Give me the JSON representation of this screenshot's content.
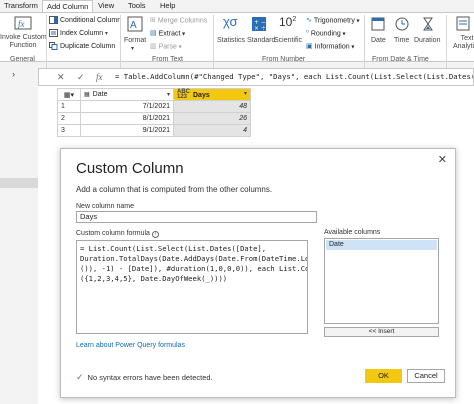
{
  "tabs": [
    "Transform",
    "Add Column",
    "View",
    "Tools",
    "Help"
  ],
  "ribbon": {
    "general": {
      "invoke_line1": "Invoke Custom",
      "invoke_line2": "Function",
      "group_label": "General"
    },
    "column_items": [
      "Conditional Column",
      "Index Column",
      "Duplicate Column"
    ],
    "from_text": {
      "format": "Format",
      "merge": "Merge Columns",
      "extract": "Extract",
      "parse": "Parse",
      "group_label": "From Text"
    },
    "from_number": {
      "statistics": "Statistics",
      "standard": "Standard",
      "scientific": "Scientific",
      "scientific_glyph": "10",
      "scientific_sup": "2",
      "trig": "Trigonometry",
      "rounding": "Rounding",
      "information": "Information",
      "group_label": "From Number"
    },
    "from_datetime": {
      "date": "Date",
      "time": "Time",
      "duration": "Duration",
      "group_label": "From Date & Time"
    },
    "text_analytics_line1": "Text",
    "text_analytics_line2": "Analytics"
  },
  "formula_bar": {
    "text": "= Table.AddColumn(#\"Changed Type\", \"Days\", each List.Count(List.Select(List.Dates([Date], Duration.TotalDays(Date.AddDays(Date.From(DateTime.LocalNow()), -1) - [Date]), #duration(1,0,0,0)), each List.Contains({1,2,3,4,5}, Date.DayOfWeek(_)))))"
  },
  "table": {
    "col_date_type": "▦",
    "col_date": "Date",
    "col_days_type_top": "ABC",
    "col_days_type_bottom": "123",
    "col_days": "Days",
    "rows": [
      {
        "n": "1",
        "date": "7/1/2021",
        "days": "48"
      },
      {
        "n": "2",
        "date": "8/1/2021",
        "days": "26"
      },
      {
        "n": "3",
        "date": "9/1/2021",
        "days": "4"
      }
    ]
  },
  "dialog": {
    "title": "Custom Column",
    "subtitle": "Add a column that is computed from the other columns.",
    "name_label": "New column name",
    "name_value": "Days",
    "formula_label": "Custom column formula",
    "formula": "= List.Count(List.Select(List.Dates([Date],\nDuration.TotalDays(Date.AddDays(Date.From(DateTime.LocalNow\n()), -1) - [Date]), #duration(1,0,0,0)), each List.Contains\n({1,2,3,4,5}, Date.DayOfWeek(_))))",
    "available_label": "Available columns",
    "available_columns": [
      "Date"
    ],
    "insert_label": "<< Insert",
    "learn_link": "Learn about Power Query formulas",
    "status": "No syntax errors have been detected.",
    "ok": "OK",
    "cancel": "Cancel"
  },
  "colors": {
    "accent": "#f2c811",
    "link": "#0e6ab5",
    "ok_check": "#3a9c3a"
  }
}
